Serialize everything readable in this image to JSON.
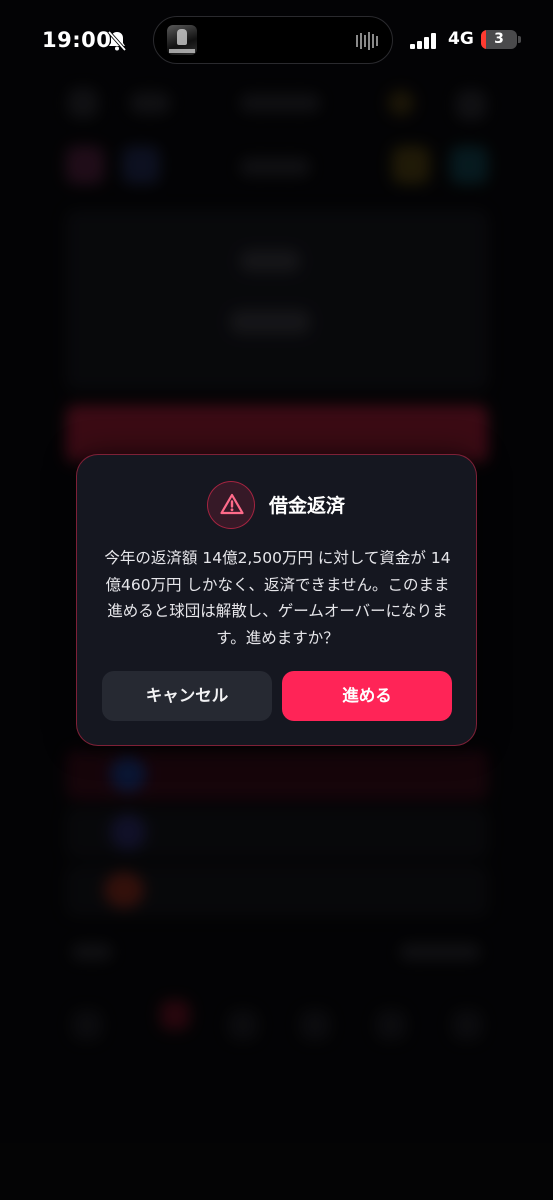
{
  "status_bar": {
    "time": "19:00",
    "network": "4G",
    "battery_level": "3",
    "icons": [
      "bell-slash-icon",
      "signal-icon",
      "battery-icon",
      "audio-wave-icon"
    ]
  },
  "dialog": {
    "icon": "warning-triangle-icon",
    "title": "借金返済",
    "message": "今年の返済額 14億2,500万円 に対して資金が 14億460万円 しかなく、返済できません。このまま進めると球団は解散し、ゲームオーバーになります。進めますか？",
    "cancel_label": "キャンセル",
    "proceed_label": "進める"
  },
  "colors": {
    "accent": "#ff2457",
    "dialog_bg": "#151720",
    "cancel_bg": "#262932"
  }
}
